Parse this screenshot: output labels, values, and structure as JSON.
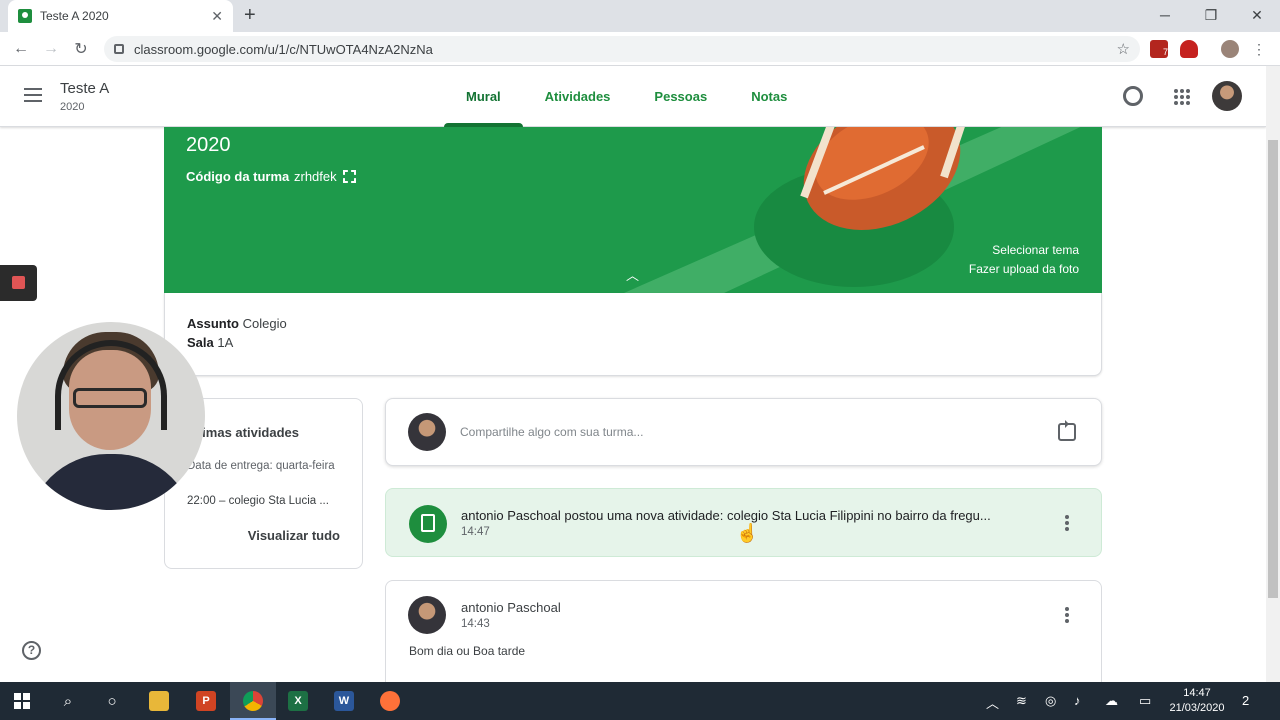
{
  "browser": {
    "tab_title": "Teste A 2020",
    "tab_close": "✕",
    "new_tab": "+",
    "url": "classroom.google.com/u/1/c/NTUwOTA4NzA2NzNa",
    "window_controls": [
      "─",
      "❐",
      "✕"
    ],
    "back": "←",
    "forward": "→",
    "reload": "↻",
    "star": "☆",
    "extension_badge": "7"
  },
  "header": {
    "class_title": "Teste A",
    "class_subtitle": "2020",
    "tabs": [
      {
        "label": "Mural",
        "active": true
      },
      {
        "label": "Atividades",
        "active": false
      },
      {
        "label": "Pessoas",
        "active": false
      },
      {
        "label": "Notas",
        "active": false
      }
    ]
  },
  "banner": {
    "year": "2020",
    "code_label": "Código da turma",
    "code": "zrhdfek",
    "select_theme": "Selecionar tema",
    "upload_photo": "Fazer upload da foto",
    "color": "#1e9a4b"
  },
  "info": {
    "subject_label": "Assunto",
    "subject": "Colegio",
    "room_label": "Sala",
    "room": "1A"
  },
  "upcoming": {
    "title": "óximas atividades",
    "due": "Data de entrega: quarta-feira",
    "item": "22:00 – colegio Sta Lucia ...",
    "view_all": "Visualizar tudo"
  },
  "share": {
    "placeholder": "Compartilhe algo com sua turma..."
  },
  "activity": {
    "text": "antonio Paschoal postou uma nova atividade: colegio Sta Lucia Filippini no bairro da fregu...",
    "time": "14:47"
  },
  "post": {
    "author": "antonio Paschoal",
    "time": "14:43",
    "body": "Bom dia ou Boa tarde"
  },
  "help": "?",
  "taskbar": {
    "time": "14:47",
    "date": "21/03/2020",
    "notifications": "2",
    "apps": [
      "windows-start",
      "search",
      "task-view",
      "file-explorer",
      "powerpoint",
      "chrome",
      "excel",
      "word",
      "firefox"
    ]
  },
  "colors": {
    "accent": "#137333",
    "activity_bg": "#e6f4ea",
    "taskbar": "#1f2a35"
  }
}
